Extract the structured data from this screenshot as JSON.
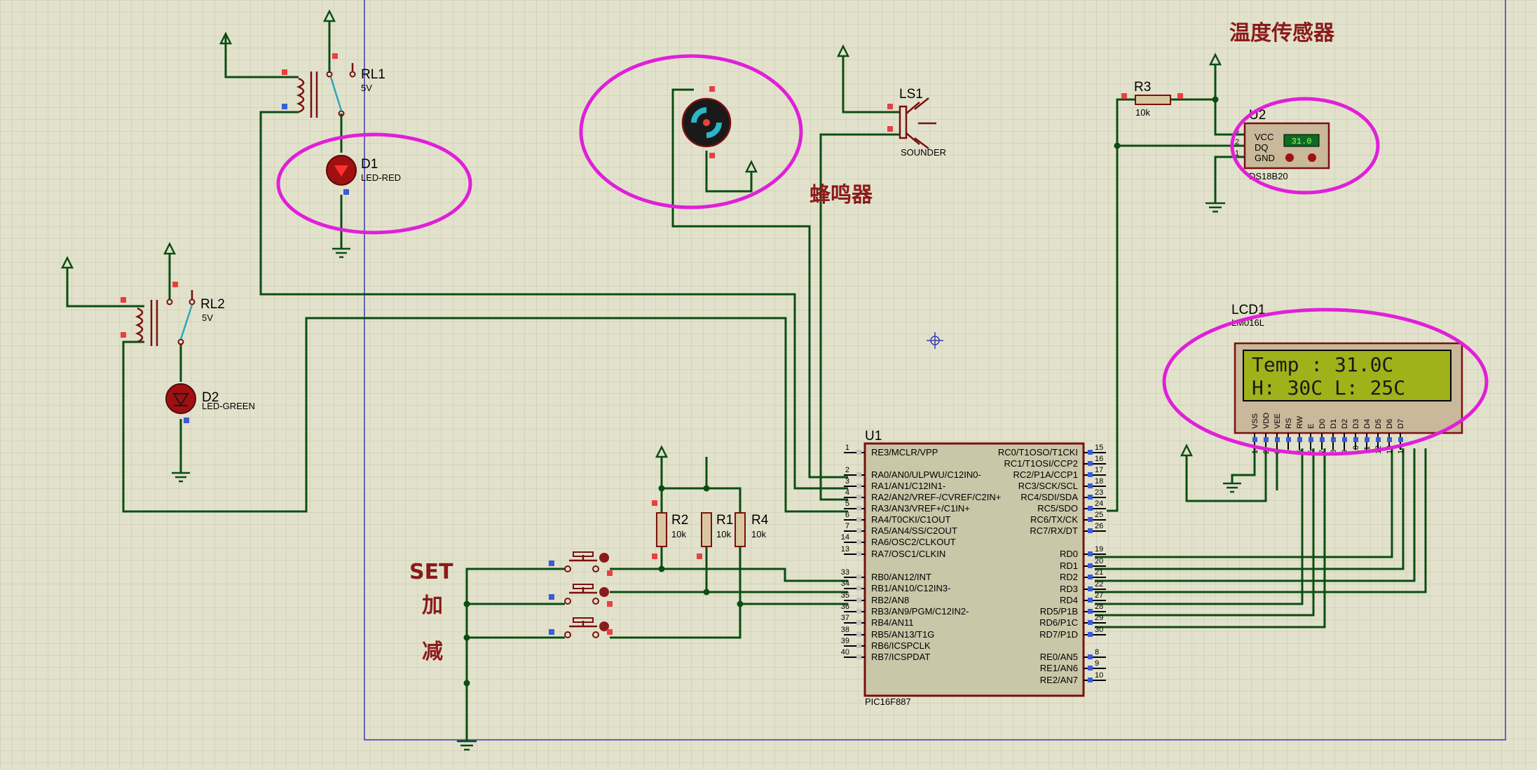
{
  "labels": {
    "temp_sensor": "温度传感器",
    "buzzer": "蜂鸣器",
    "set": "SET",
    "plus": "加",
    "minus": "减"
  },
  "mcu": {
    "ref": "U1",
    "part": "PIC16F887",
    "left_pins": [
      {
        "num": "1",
        "name": "RE3/MCLR/VPP"
      },
      {
        "num": "2",
        "name": "RA0/AN0/ULPWU/C12IN0-"
      },
      {
        "num": "3",
        "name": "RA1/AN1/C12IN1-"
      },
      {
        "num": "4",
        "name": "RA2/AN2/VREF-/CVREF/C2IN+"
      },
      {
        "num": "5",
        "name": "RA3/AN3/VREF+/C1IN+"
      },
      {
        "num": "6",
        "name": "RA4/T0CKI/C1OUT"
      },
      {
        "num": "7",
        "name": "RA5/AN4/SS/C2OUT"
      },
      {
        "num": "14",
        "name": "RA6/OSC2/CLKOUT"
      },
      {
        "num": "13",
        "name": "RA7/OSC1/CLKIN"
      },
      {
        "num": "33",
        "name": "RB0/AN12/INT"
      },
      {
        "num": "34",
        "name": "RB1/AN10/C12IN3-"
      },
      {
        "num": "35",
        "name": "RB2/AN8"
      },
      {
        "num": "36",
        "name": "RB3/AN9/PGM/C12IN2-"
      },
      {
        "num": "37",
        "name": "RB4/AN11"
      },
      {
        "num": "38",
        "name": "RB5/AN13/T1G"
      },
      {
        "num": "39",
        "name": "RB6/ICSPCLK"
      },
      {
        "num": "40",
        "name": "RB7/ICSPDAT"
      }
    ],
    "right_pins": [
      {
        "num": "15",
        "name": "RC0/T1OSO/T1CKI"
      },
      {
        "num": "16",
        "name": "RC1/T1OSI/CCP2"
      },
      {
        "num": "17",
        "name": "RC2/P1A/CCP1"
      },
      {
        "num": "18",
        "name": "RC3/SCK/SCL"
      },
      {
        "num": "23",
        "name": "RC4/SDI/SDA"
      },
      {
        "num": "24",
        "name": "RC5/SDO"
      },
      {
        "num": "25",
        "name": "RC6/TX/CK"
      },
      {
        "num": "26",
        "name": "RC7/RX/DT"
      },
      {
        "num": "19",
        "name": "RD0"
      },
      {
        "num": "20",
        "name": "RD1"
      },
      {
        "num": "21",
        "name": "RD2"
      },
      {
        "num": "22",
        "name": "RD3"
      },
      {
        "num": "27",
        "name": "RD4"
      },
      {
        "num": "28",
        "name": "RD5/P1B"
      },
      {
        "num": "29",
        "name": "RD6/P1C"
      },
      {
        "num": "30",
        "name": "RD7/P1D"
      },
      {
        "num": "8",
        "name": "RE0/AN5"
      },
      {
        "num": "9",
        "name": "RE1/AN6"
      },
      {
        "num": "10",
        "name": "RE2/AN7"
      }
    ]
  },
  "lcd": {
    "ref": "LCD1",
    "part": "LM016L",
    "line1": "Temp : 31.0C",
    "line2": "H: 30C  L: 25C",
    "pins": [
      "VSS",
      "VDD",
      "VEE",
      "RS",
      "RW",
      "E",
      "D0",
      "D1",
      "D2",
      "D3",
      "D4",
      "D5",
      "D6",
      "D7"
    ]
  },
  "sensor": {
    "ref": "U2",
    "part": "DS18B20",
    "reading": "31.0",
    "pins": [
      {
        "num": "3",
        "name": "VCC"
      },
      {
        "num": "2",
        "name": "DQ"
      },
      {
        "num": "1",
        "name": "GND"
      }
    ]
  },
  "relay1": {
    "ref": "RL1",
    "value": "5V"
  },
  "relay2": {
    "ref": "RL2",
    "value": "5V"
  },
  "led1": {
    "ref": "D1",
    "value": "LED-RED"
  },
  "led2": {
    "ref": "D2",
    "value": "LED-GREEN"
  },
  "buzzer_part": {
    "ref": "LS1",
    "value": "SOUNDER"
  },
  "resistors": [
    {
      "ref": "R3",
      "value": "10k"
    },
    {
      "ref": "R2",
      "value": "10k"
    },
    {
      "ref": "R1",
      "value": "10k"
    },
    {
      "ref": "R4",
      "value": "10k"
    }
  ],
  "colors": {
    "background": "#e2e2cc",
    "grid": "#c6c6ad",
    "wire": "#0b4d12",
    "component": "#7a1010",
    "highlight": "#e020d8",
    "chip_body": "#c9c7a8",
    "lcd_screen": "#9fb21a"
  }
}
